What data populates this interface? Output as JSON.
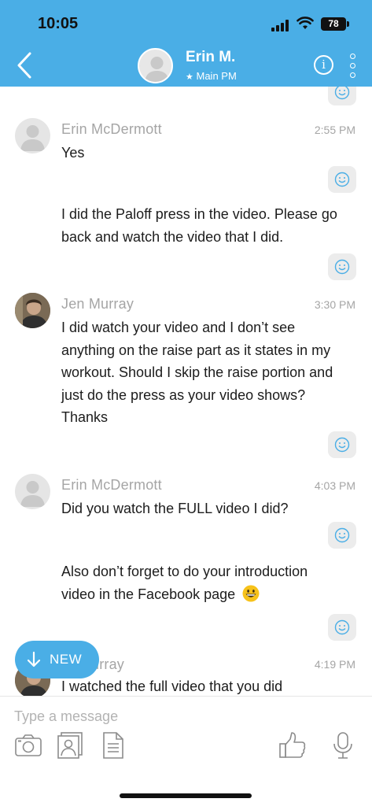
{
  "status": {
    "time": "10:05",
    "battery": "78"
  },
  "header": {
    "name": "Erin M.",
    "subtitle": "Main PM",
    "info": "i"
  },
  "messages": [
    {
      "sender": "Erin McDermott",
      "time": "2:55 PM",
      "text": "Yes"
    },
    {
      "text": "I did the Paloff press in the video. Please go back and watch the video that I did."
    },
    {
      "sender": "Jen Murray",
      "time": "3:30 PM",
      "text": "I did watch your video and I don’t see anything on the raise part as it states in my workout. Should I skip the raise portion and just do the press as your video shows? Thanks"
    },
    {
      "sender": "Erin McDermott",
      "time": "4:03 PM",
      "text": "Did you watch the FULL video I did?"
    },
    {
      "text": "Also don’t forget to do your introduction video in the Facebook page"
    },
    {
      "sender": "urray",
      "time": "4:19 PM",
      "text": "I watched the full video that you did"
    }
  ],
  "new_button": {
    "label": "NEW"
  },
  "composer": {
    "placeholder": "Type a message"
  },
  "colors": {
    "accent": "#4aaee6",
    "react_bg": "#ececec",
    "meta": "#a5a5a5"
  }
}
